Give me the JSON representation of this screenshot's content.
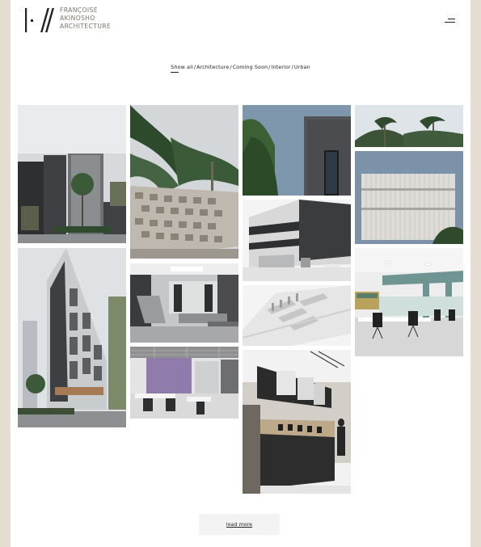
{
  "brand": {
    "line1": "FRANÇOISE",
    "line2": "AKINOSHO",
    "line3": "ARCHITECTURE"
  },
  "filters": {
    "show_all": "Show all",
    "architecture": "Architecture",
    "coming_soon": "Coming Soon",
    "interior": "Interior",
    "urban": "Urban"
  },
  "load_more": "load more",
  "colors": {
    "page_bg": "#ffffff",
    "outer_bg": "#e4ddd2",
    "logo_text": "#7c7468"
  },
  "icons": {
    "menu": "hamburger-menu-icon",
    "logo": "fa-monogram-logo"
  }
}
